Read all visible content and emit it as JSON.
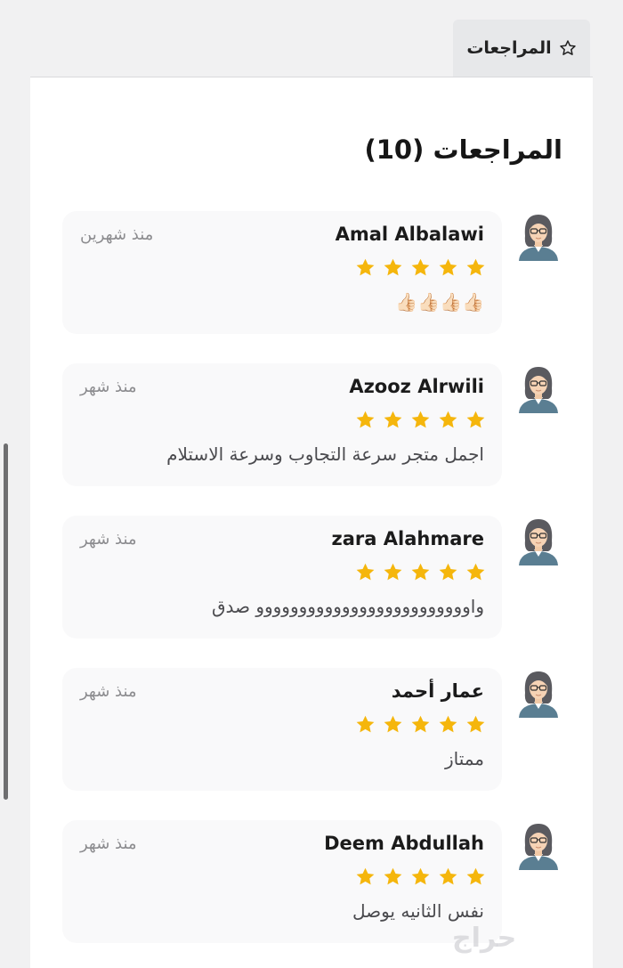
{
  "tab": {
    "label": "المراجعات",
    "icon": "star-outline-icon"
  },
  "section": {
    "title": "المراجعات (10)"
  },
  "colors": {
    "star": "#f5b60c",
    "card_background": "#f9f9fa",
    "muted_text": "#8c8c8f"
  },
  "reviews": [
    {
      "name": "Amal Albalawi",
      "time": "منذ شهرين",
      "rating": 5,
      "text": "👍🏻👍🏻👍🏻👍🏻"
    },
    {
      "name": "Azooz Alrwili",
      "time": "منذ شهر",
      "rating": 5,
      "text": "اجمل متجر سرعة التجاوب وسرعة الاستلام"
    },
    {
      "name": "zara Alahmare",
      "time": "منذ شهر",
      "rating": 5,
      "text": "واووووووووووووووووووووووووو صدق"
    },
    {
      "name": "عمار أحمد",
      "time": "منذ شهر",
      "rating": 5,
      "text": "ممتاز"
    },
    {
      "name": "Deem Abdullah",
      "time": "منذ شهر",
      "rating": 5,
      "text": "نفس الثانيه يوصل"
    }
  ],
  "watermark": "حراج"
}
